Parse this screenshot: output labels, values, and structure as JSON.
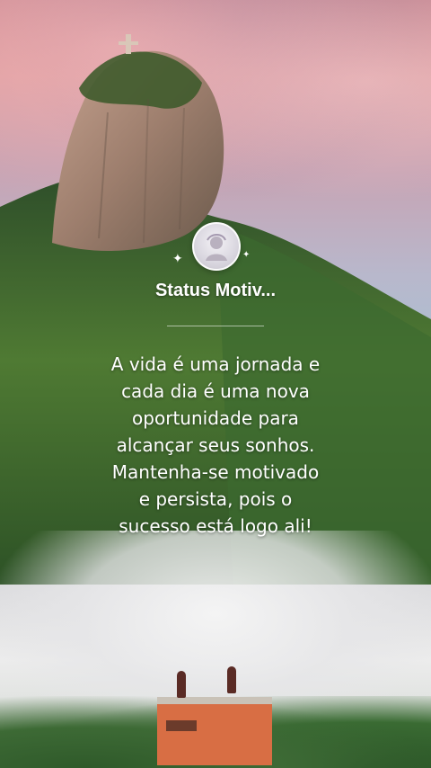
{
  "card": {
    "title": "Status Motiv...",
    "quote": "A vida é uma jornada e\ncada dia é uma nova\noportunidade para\nalcançar seus sonhos.\nMantenha-se motivado\ne persista, pois o\nsucesso está logo ali!"
  },
  "icons": {
    "avatar": "profile-avatar-icon",
    "sparkle": "sparkle-icon"
  },
  "colors": {
    "text": "#ffffff",
    "sky_top": "#c98a93",
    "mountain": "#3b5f2b",
    "house": "#d86e44"
  }
}
